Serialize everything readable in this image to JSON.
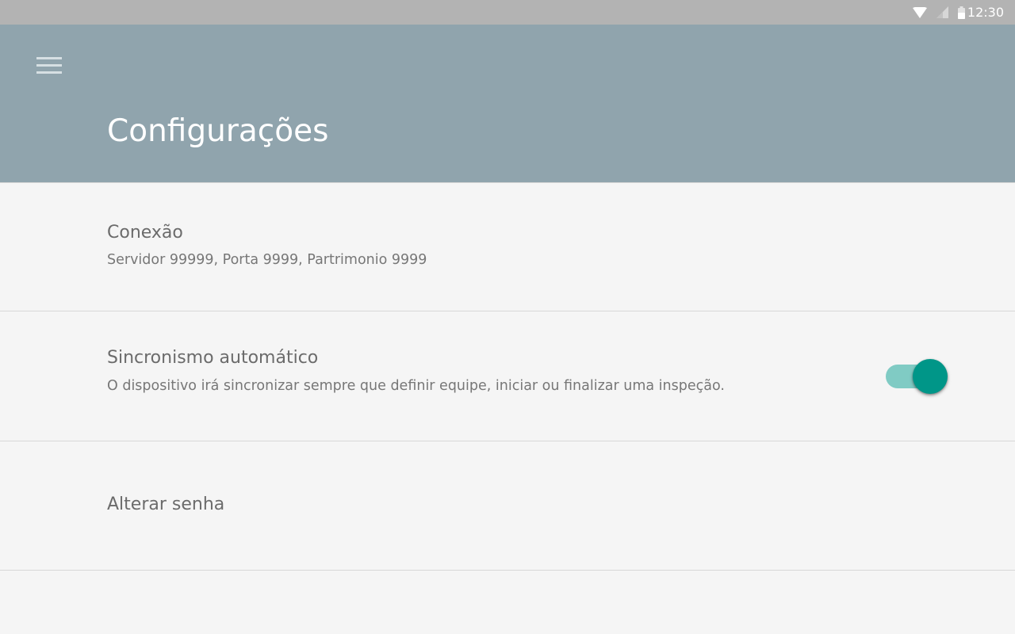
{
  "status_bar": {
    "time": "12:30",
    "icons": [
      "wifi-icon",
      "cell-signal-icon",
      "battery-icon"
    ]
  },
  "app_bar": {
    "title": "Configurações",
    "menu_icon": "hamburger-menu-icon",
    "background_color": "#90a4ad"
  },
  "settings": {
    "items": [
      {
        "title": "Conexão",
        "summary": "Servidor 99999, Porta 9999, Partrimonio 9999"
      },
      {
        "title": "Sincronismo automático",
        "summary": "O dispositivo irá sincronizar sempre que definir equipe, iniciar ou finalizar uma inspeção.",
        "toggle_on": true,
        "accent_color": "#009688"
      },
      {
        "title": "Alterar senha"
      }
    ]
  }
}
